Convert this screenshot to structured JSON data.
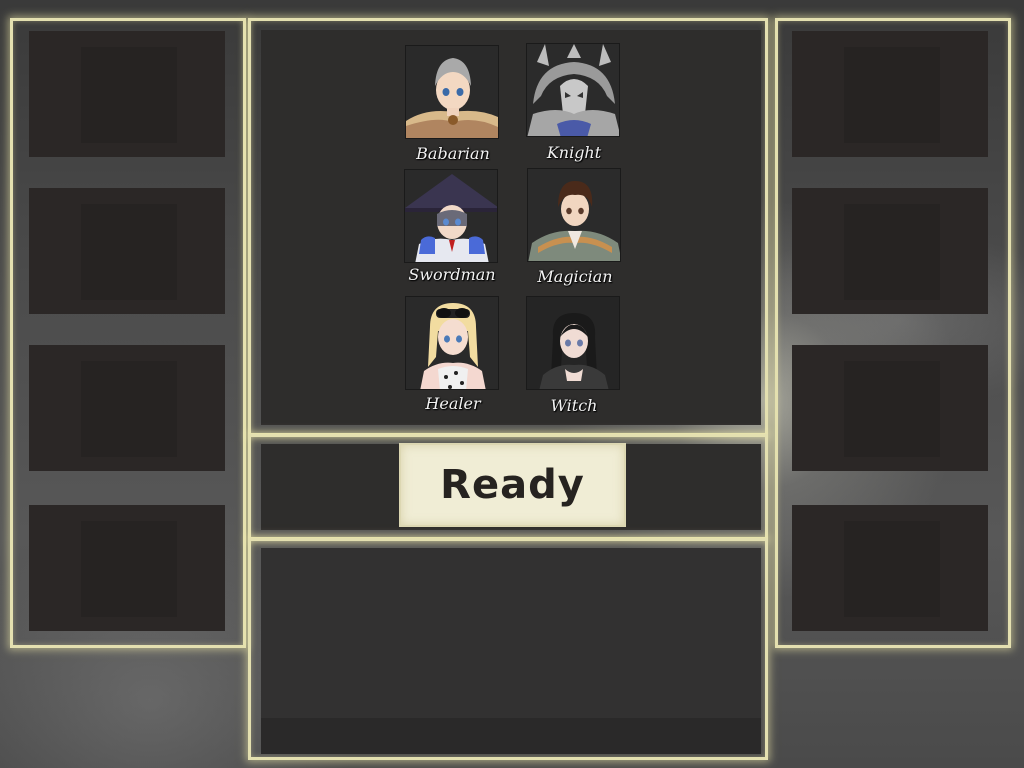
{
  "characters": [
    {
      "name": "Babarian",
      "icon": "barbarian-portrait-icon"
    },
    {
      "name": "Knight",
      "icon": "knight-portrait-icon"
    },
    {
      "name": "Swordman",
      "icon": "swordman-portrait-icon"
    },
    {
      "name": "Magician",
      "icon": "magician-portrait-icon"
    },
    {
      "name": "Healer",
      "icon": "healer-portrait-icon"
    },
    {
      "name": "Witch",
      "icon": "witch-portrait-icon"
    }
  ],
  "ready_button": {
    "label": "Ready"
  },
  "colors": {
    "frame_glow": "#e4e0b0",
    "panel": "#2e2d2c",
    "button_bg": "#f0edd5",
    "button_text": "#262320"
  }
}
